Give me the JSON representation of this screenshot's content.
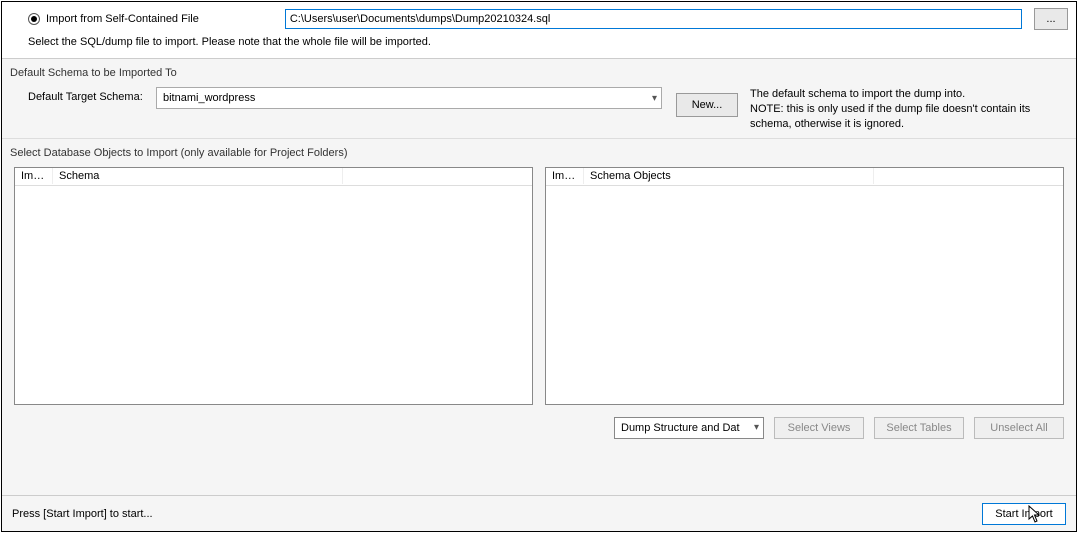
{
  "radio": {
    "label": "Import from Self-Contained File"
  },
  "file": {
    "path": "C:\\Users\\user\\Documents\\dumps\\Dump20210324.sql"
  },
  "browse": {
    "label": "..."
  },
  "hint": "Select the SQL/dump file to import. Please note that the whole file will be imported.",
  "schemaSection": {
    "header": "Default Schema to be Imported To",
    "label": "Default Target Schema:",
    "selected": "bitnami_wordpress",
    "newLabel": "New...",
    "note1": "The default schema to import the dump into.",
    "note2": "NOTE: this is only used if the dump file doesn't contain its schema, otherwise it is ignored."
  },
  "objects": {
    "header": "Select Database Objects to Import (only available for Project Folders)",
    "leftCols": {
      "imp": "Imp...",
      "schema": "Schema"
    },
    "rightCols": {
      "imp": "Imp...",
      "schemaObj": "Schema Objects"
    }
  },
  "dumpCombo": "Dump Structure and Dat",
  "buttons": {
    "selectViews": "Select Views",
    "selectTables": "Select Tables",
    "unselectAll": "Unselect All",
    "startImport": "Start Import"
  },
  "status": "Press [Start Import] to start..."
}
